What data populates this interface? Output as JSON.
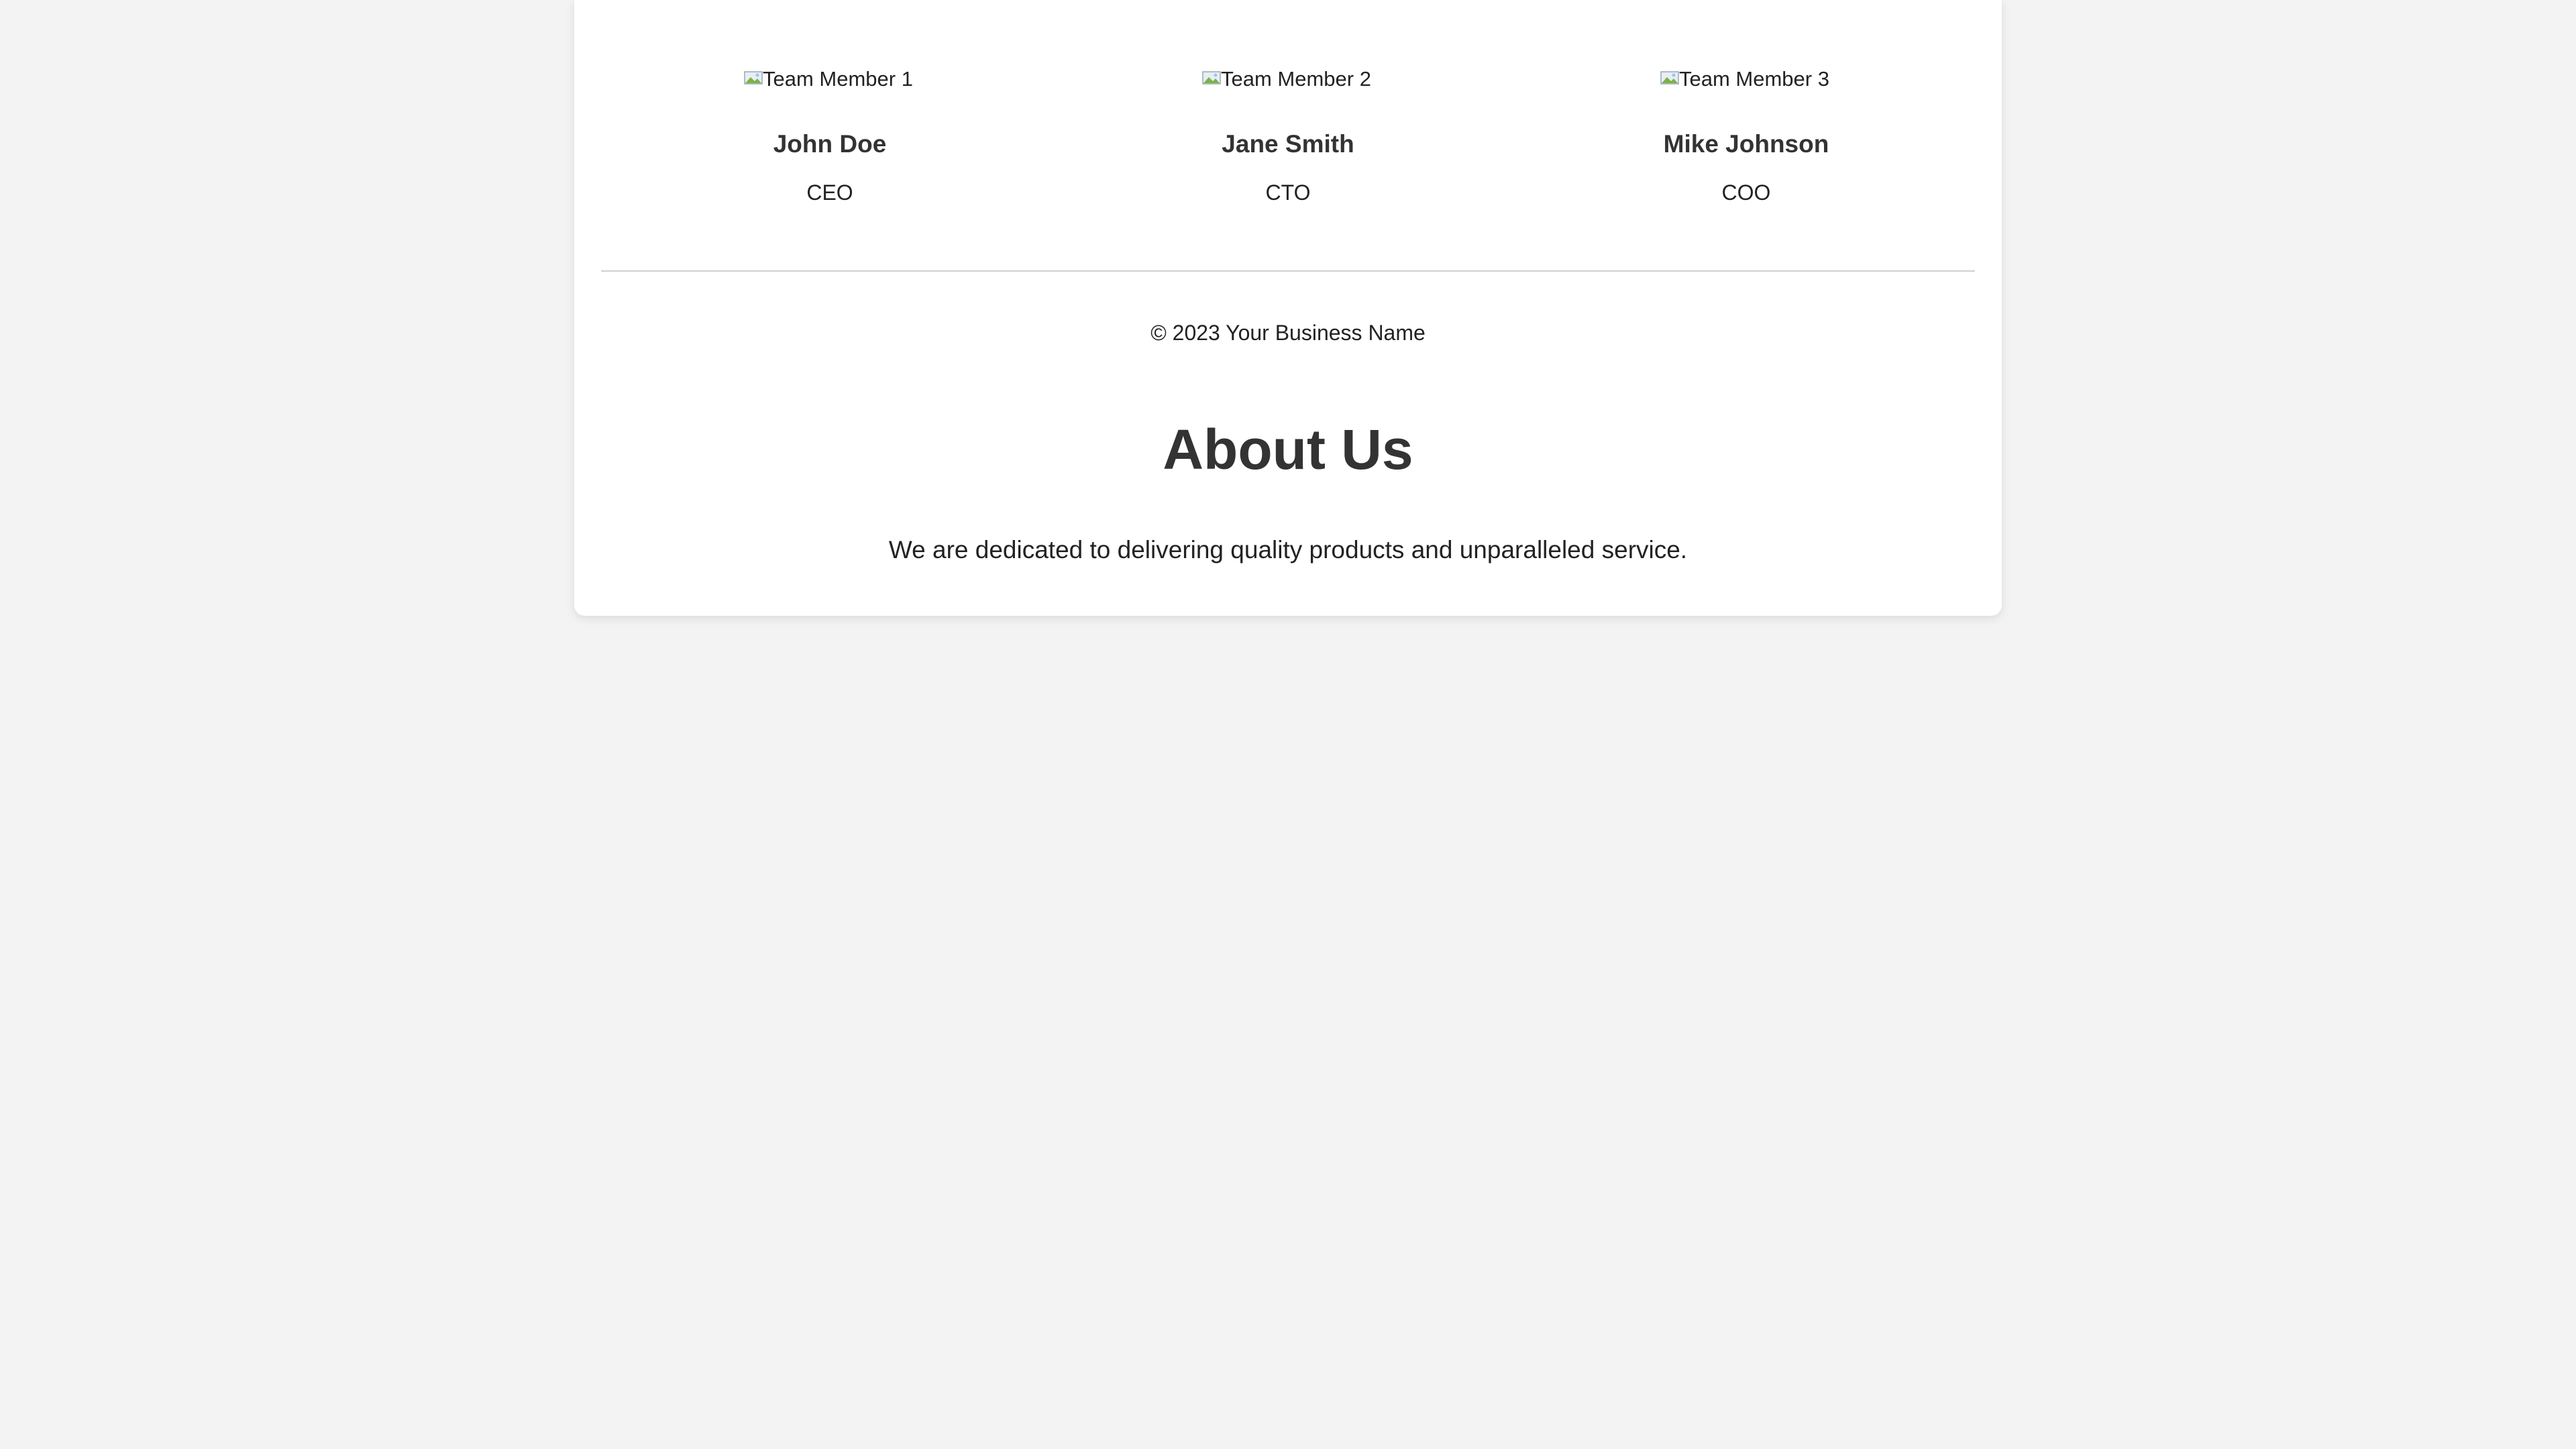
{
  "team": {
    "members": [
      {
        "image_alt": "Team Member 1",
        "name": "John Doe",
        "role": "CEO"
      },
      {
        "image_alt": "Team Member 2",
        "name": "Jane Smith",
        "role": "CTO"
      },
      {
        "image_alt": "Team Member 3",
        "name": "Mike Johnson",
        "role": "COO"
      }
    ]
  },
  "footer": {
    "copyright": "© 2023 Your Business Name"
  },
  "about": {
    "title": "About Us",
    "text": "We are dedicated to delivering quality products and unparalleled service."
  },
  "colors": {
    "page_background": "#f3f3f3",
    "card_background": "#ffffff",
    "heading_text": "#333333",
    "divider": "#d0d0d0"
  },
  "icons": {
    "broken_image": "broken-image-icon"
  }
}
